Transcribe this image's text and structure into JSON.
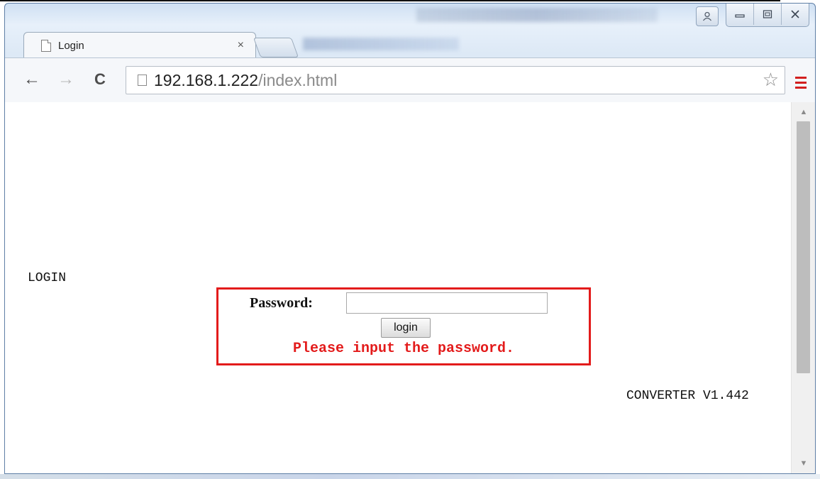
{
  "browser": {
    "tab": {
      "title": "Login",
      "close": "×"
    },
    "address": {
      "host": "192.168.1.222",
      "path": "/index.html"
    },
    "nav": {
      "back": "←",
      "forward": "→",
      "reload": "C"
    },
    "star": "☆"
  },
  "page": {
    "heading": "LOGIN",
    "form": {
      "password_label": "Password:",
      "password_value": "",
      "button_label": "login",
      "error": "Please input the password."
    },
    "version": "CONVERTER V1.442"
  },
  "colors": {
    "error": "#e31b1b",
    "menu_icon": "#d21f1f"
  }
}
